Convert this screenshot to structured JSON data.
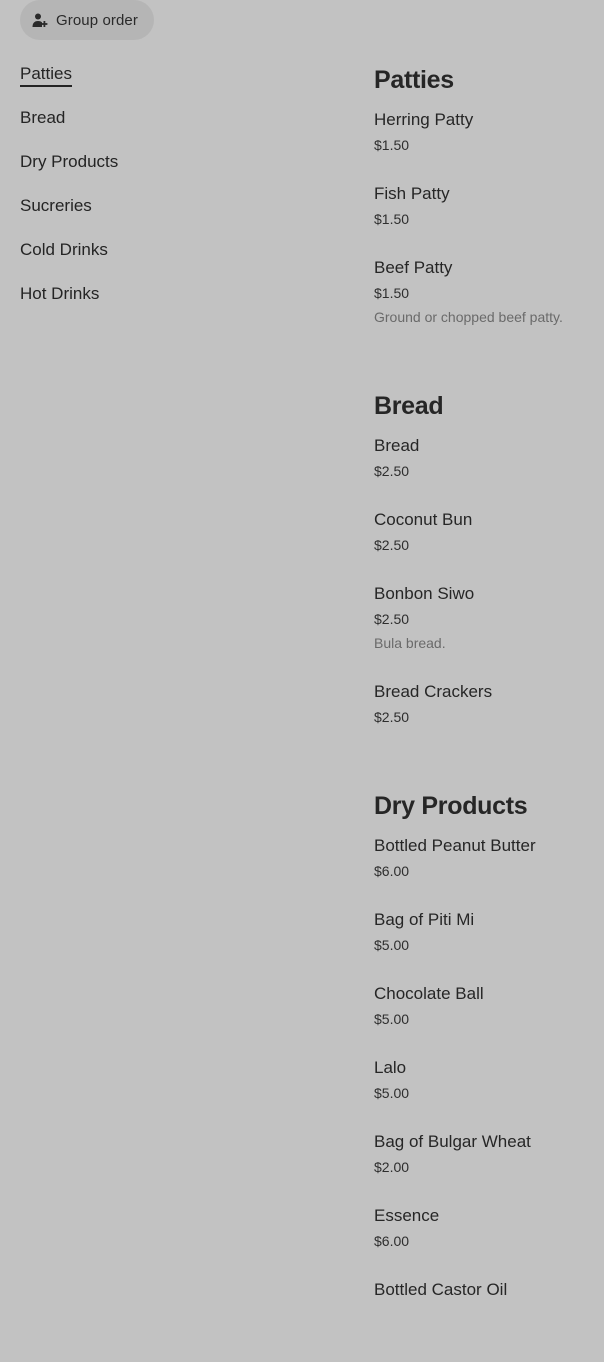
{
  "group_order": {
    "label": "Group order",
    "icon": "person-add-icon"
  },
  "sidebar": {
    "items": [
      {
        "label": "Patties",
        "active": true
      },
      {
        "label": "Bread",
        "active": false
      },
      {
        "label": "Dry Products",
        "active": false
      },
      {
        "label": "Sucreries",
        "active": false
      },
      {
        "label": "Cold Drinks",
        "active": false
      },
      {
        "label": "Hot Drinks",
        "active": false
      }
    ]
  },
  "menu": {
    "sections": [
      {
        "title": "Patties",
        "items": [
          {
            "name": "Herring Patty",
            "price": "$1.50",
            "description": ""
          },
          {
            "name": "Fish Patty",
            "price": "$1.50",
            "description": ""
          },
          {
            "name": "Beef Patty",
            "price": "$1.50",
            "description": "Ground or chopped beef patty."
          }
        ]
      },
      {
        "title": "Bread",
        "items": [
          {
            "name": "Bread",
            "price": "$2.50",
            "description": ""
          },
          {
            "name": "Coconut Bun",
            "price": "$2.50",
            "description": ""
          },
          {
            "name": "Bonbon Siwo",
            "price": "$2.50",
            "description": "Bula bread."
          },
          {
            "name": "Bread Crackers",
            "price": "$2.50",
            "description": ""
          }
        ]
      },
      {
        "title": "Dry Products",
        "items": [
          {
            "name": "Bottled Peanut Butter",
            "price": "$6.00",
            "description": ""
          },
          {
            "name": "Bag of Piti Mi",
            "price": "$5.00",
            "description": ""
          },
          {
            "name": "Chocolate Ball",
            "price": "$5.00",
            "description": ""
          },
          {
            "name": "Lalo",
            "price": "$5.00",
            "description": ""
          },
          {
            "name": "Bag of Bulgar Wheat",
            "price": "$2.00",
            "description": ""
          },
          {
            "name": "Essence",
            "price": "$6.00",
            "description": ""
          },
          {
            "name": "Bottled Castor Oil",
            "price": "",
            "description": ""
          }
        ]
      }
    ]
  },
  "colors": {
    "background": "#c2c2c2",
    "pill": "#b5b5b5",
    "text": "#242424",
    "muted": "#6a6a6a"
  }
}
